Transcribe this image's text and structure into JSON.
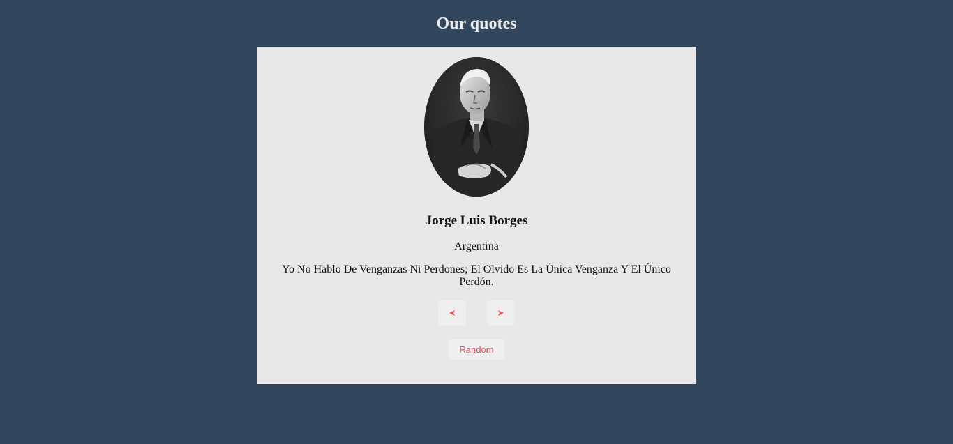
{
  "header": {
    "title": "Our quotes"
  },
  "quote_card": {
    "portrait_icon": "author-portrait",
    "author_name": "Jorge Luis Borges",
    "author_country": "Argentina",
    "quote": "Yo No Hablo De Venganzas Ni Perdones; El Olvido Es La Única Venganza Y El Único Perdón.",
    "prev_icon": "caret-left-icon",
    "next_icon": "caret-right-icon",
    "random_label": "Random"
  },
  "colors": {
    "background": "#32475e",
    "card": "#e9e8e8",
    "accent": "#e0535d"
  }
}
